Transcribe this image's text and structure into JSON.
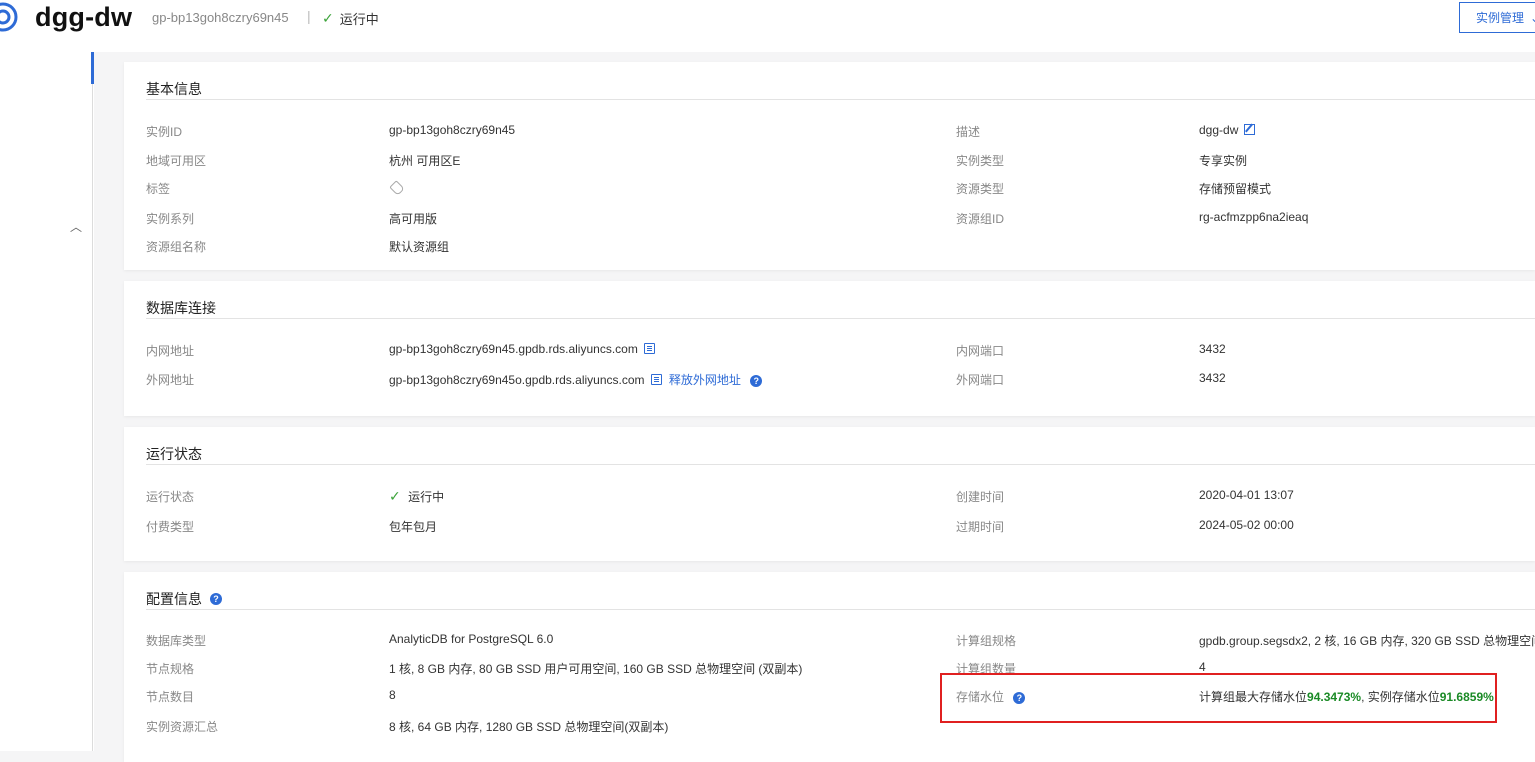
{
  "header": {
    "title": "dgg-dw",
    "instance_id": "gp-bp13goh8czry69n45",
    "separator": "|",
    "status": "运行中",
    "manage_button": "实例管理"
  },
  "basic": {
    "title": "基本信息",
    "left": [
      {
        "label": "实例ID",
        "value": "gp-bp13goh8czry69n45"
      },
      {
        "label": "地域可用区",
        "value": "杭州 可用区E"
      },
      {
        "label": "标签",
        "value": ""
      },
      {
        "label": "实例系列",
        "value": "高可用版"
      },
      {
        "label": "资源组名称",
        "value": "默认资源组"
      }
    ],
    "right": [
      {
        "label": "描述",
        "value": "dgg-dw"
      },
      {
        "label": "实例类型",
        "value": "专享实例"
      },
      {
        "label": "资源类型",
        "value": "存储预留模式"
      },
      {
        "label": "资源组ID",
        "value": "rg-acfmzpp6na2ieaq"
      }
    ]
  },
  "connection": {
    "title": "数据库连接",
    "left": [
      {
        "label": "内网地址",
        "value": "gp-bp13goh8czry69n45.gpdb.rds.aliyuncs.com"
      },
      {
        "label": "外网地址",
        "value": "gp-bp13goh8czry69n45o.gpdb.rds.aliyuncs.com",
        "action": "释放外网地址"
      }
    ],
    "right": [
      {
        "label": "内网端口",
        "value": "3432"
      },
      {
        "label": "外网端口",
        "value": "3432"
      }
    ]
  },
  "runtime": {
    "title": "运行状态",
    "left": [
      {
        "label": "运行状态",
        "value": "运行中"
      },
      {
        "label": "付费类型",
        "value": "包年包月"
      }
    ],
    "right": [
      {
        "label": "创建时间",
        "value": "2020-04-01 13:07"
      },
      {
        "label": "过期时间",
        "value": "2024-05-02 00:00"
      }
    ]
  },
  "config": {
    "title": "配置信息",
    "left": [
      {
        "label": "数据库类型",
        "value": "AnalyticDB for PostgreSQL 6.0"
      },
      {
        "label": "节点规格",
        "value": "1 核, 8 GB 内存, 80 GB SSD 用户可用空间, 160 GB SSD 总物理空间 (双副本)"
      },
      {
        "label": "节点数目",
        "value": "8"
      },
      {
        "label": "实例资源汇总",
        "value": "8 核, 64 GB 内存, 1280 GB SSD 总物理空间(双副本)"
      }
    ],
    "right": [
      {
        "label": "计算组规格",
        "value": "gpdb.group.segsdx2, 2 核, 16 GB 内存, 320 GB SSD 总物理空间("
      },
      {
        "label": "计算组数量",
        "value": "4"
      },
      {
        "label": "存储水位",
        "prefix": "计算组最大存储水位",
        "pct1": "94.3473%",
        "mid": ", 实例存储水位",
        "pct2": "91.6859%"
      }
    ]
  },
  "colors": {
    "accent": "#2e6bd6",
    "green": "#1a8a25",
    "highlight": "#e02020"
  }
}
